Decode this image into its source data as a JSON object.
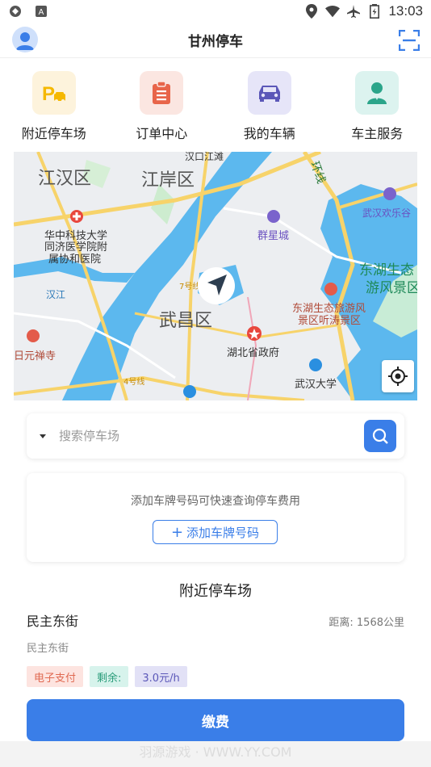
{
  "status": {
    "time": "13:03"
  },
  "app": {
    "title": "甘州停车"
  },
  "quick": [
    {
      "label": "附近停车场",
      "bg": "#fdf3dc"
    },
    {
      "label": "订单中心",
      "bg": "#fbe6e1"
    },
    {
      "label": "我的车辆",
      "bg": "#e6e5f8"
    },
    {
      "label": "车主服务",
      "bg": "#dcf3ef"
    }
  ],
  "map": {
    "labels": [
      "江汉区",
      "江岸区",
      "汉口江滩",
      "华中科技大学",
      "同济医学院附",
      "属协和医院",
      "汉江",
      "群星城",
      "武汉欢乐谷",
      "东湖生态",
      "游风景区",
      "东湖生态旅游风",
      "景区听涛景区",
      "武昌区",
      "湖北省政府",
      "日元禅寺",
      "武汉大学",
      "7号线",
      "4号线",
      "环线"
    ]
  },
  "search": {
    "placeholder": "搜索停车场"
  },
  "plate": {
    "hint": "添加车牌号码可快速查询停车费用",
    "button": "添加车牌号码"
  },
  "section": {
    "title": "附近停车场"
  },
  "lot": {
    "name": "民主东街",
    "distance": "距离: 1568公里",
    "address": "民主东街",
    "tags": [
      "电子支付",
      "剩余:",
      "3.0元/h"
    ]
  },
  "pay": {
    "label": "缴费"
  },
  "watermark": "羽源游戏 · WWW.YY.COM",
  "colors": {
    "primary": "#3a7ee8"
  }
}
